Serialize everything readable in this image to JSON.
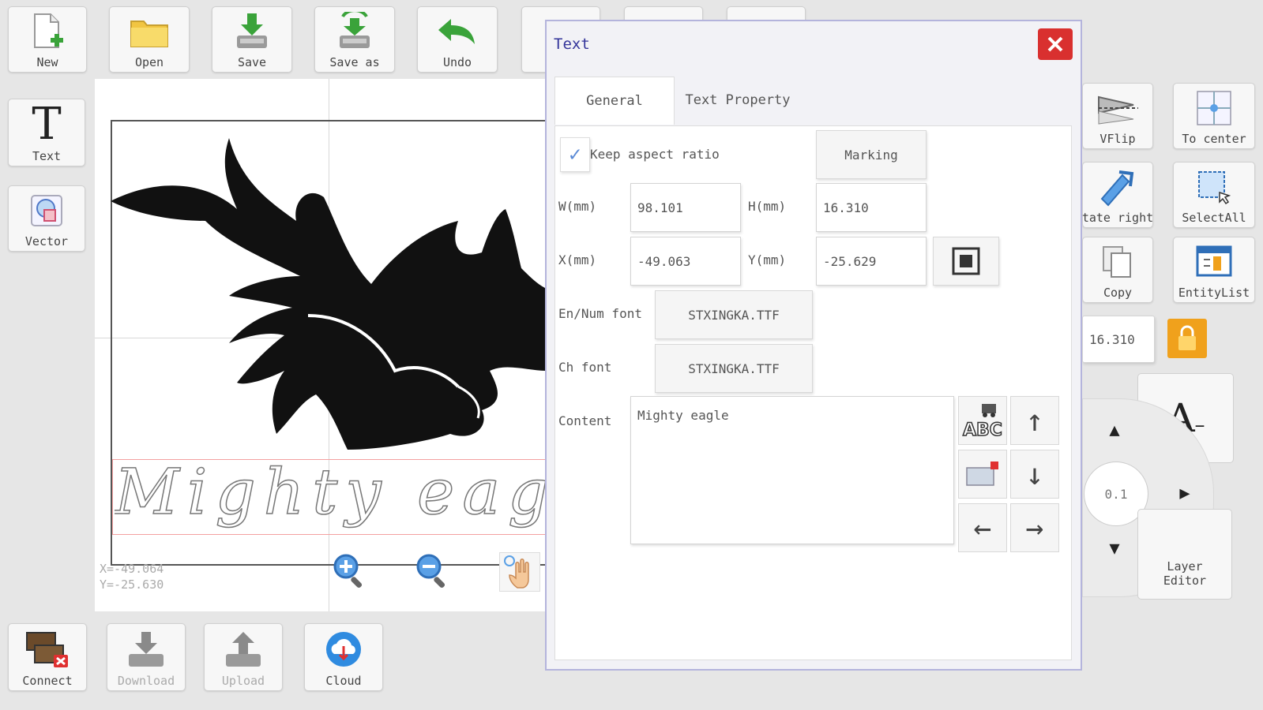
{
  "toolbar": {
    "new": "New",
    "open": "Open",
    "save": "Save",
    "save_as": "Save as",
    "undo": "Undo"
  },
  "left_tools": {
    "text": "Text",
    "vector": "Vector"
  },
  "canvas": {
    "text_preview": "Mighty eagle",
    "coord_x": "X=-49.064",
    "coord_y": "Y=-25.630"
  },
  "bottom_toolbar": {
    "connect": "Connect",
    "download": "Download",
    "upload": "Upload",
    "cloud": "Cloud"
  },
  "right_panel": {
    "vflip": "VFlip",
    "to_center": "To center",
    "rotate_right": "tate right",
    "select_all": "SelectAll",
    "copy": "Copy",
    "entity_list": "EntityList",
    "size_value": "16.310",
    "step_value": "0.1",
    "layer_editor": "Layer\nEditor"
  },
  "dialog": {
    "title": "Text",
    "tabs": [
      "General",
      "Text Property"
    ],
    "keep_aspect_label": "Keep aspect ratio",
    "marking_label": "Marking",
    "w_label": "W(mm)",
    "w_value": "98.101",
    "h_label": "H(mm)",
    "h_value": "16.310",
    "x_label": "X(mm)",
    "x_value": "-49.063",
    "y_label": "Y(mm)",
    "y_value": "-25.629",
    "en_font_label": "En/Num font",
    "en_font_value": "STXINGKA.TTF",
    "ch_font_label": "Ch font",
    "ch_font_value": "STXINGKA.TTF",
    "content_label": "Content",
    "content_value": "Mighty eagle"
  },
  "colors": {
    "accent": "#33349a",
    "close": "#d9302f",
    "lock": "#f0a11c"
  }
}
